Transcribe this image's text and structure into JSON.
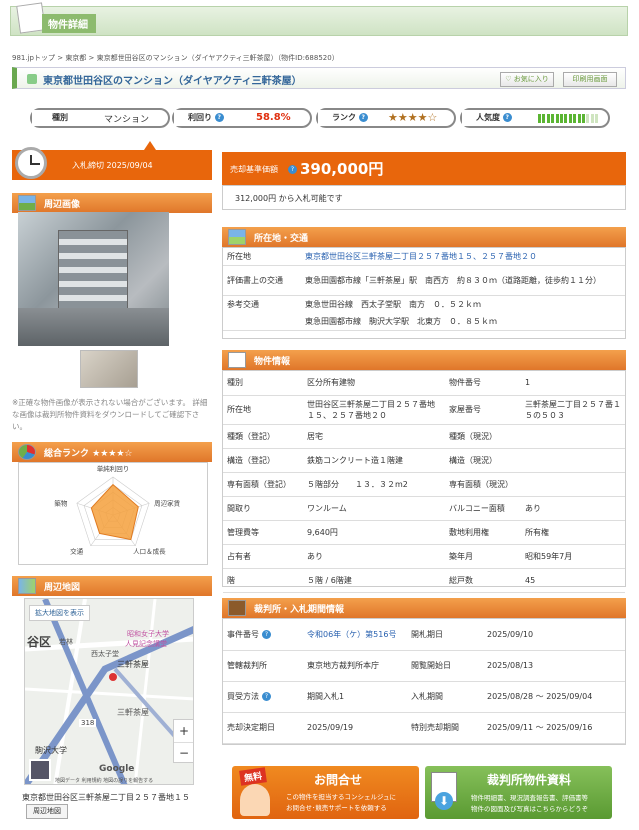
{
  "header": {
    "title": "物件詳細"
  },
  "breadcrumb": [
    "981.jpトップ",
    "東京都",
    "東京都世田谷区のマンション（ダイヤアクティ三軒茶屋）（物件ID:688520）"
  ],
  "property": {
    "title": "東京都世田谷区のマンション（ダイヤアクティ三軒茶屋）",
    "fav_label": "お気に入り",
    "print_label": "印刷用画面"
  },
  "stats": {
    "type_label": "種別",
    "type_value": "マンション",
    "yield_label": "利回り",
    "yield_value": "58.8%",
    "rank_label": "ランク",
    "rank_stars": "★★★★☆",
    "rank_value": 4,
    "popularity_label": "人気度",
    "popularity_level": 0.75
  },
  "auction": {
    "deadline": "入札締切 2025/09/04"
  },
  "price": {
    "label": "売却基準価額",
    "value": "390,000円",
    "sub": "312,000円 から入札可能です"
  },
  "photos": {
    "title": "周辺画像",
    "note": "※正確な物件画像が表示されない場合がございます。 詳細な画像は裁判所物件資料をダウンロードしてご確認下さい。"
  },
  "overall": {
    "title": "総合ランク ★★★★☆",
    "axes": [
      "単純利回り",
      "周辺家賃",
      "人口＆成長",
      "交通",
      "築物"
    ],
    "values": [
      4,
      3.5,
      4,
      3,
      3
    ],
    "max": 5
  },
  "map": {
    "title": "周辺地図",
    "enlarge": "拡大地図を表示",
    "labels": [
      "谷区",
      "三軒茶屋",
      "西太子堂",
      "若林",
      "昭和女子大学",
      "人見記念講堂",
      "三軒茶屋",
      "駒沢大学",
      "318",
      "Google"
    ],
    "attribution": "地図データ 利用規約 地図の誤りを報告する",
    "zoom_in": "+",
    "zoom_out": "−",
    "address": "東京都世田谷区三軒茶屋二丁目２５７番地１５",
    "map_button": "周辺地図"
  },
  "location": {
    "title": "所在地・交通",
    "rows": [
      {
        "label": "所在地",
        "value": "東京都世田谷区三軒茶屋二丁目２５７番地１５、２５７番地２０"
      },
      {
        "label": "評価書上の交通",
        "value": "東急田園都市線「三軒茶屋」駅　南西方　約８３０ｍ（道路距離，徒歩約１１分）"
      },
      {
        "label": "参考交通",
        "value": "東急世田谷線　西太子堂駅　南方　０．５２ｋｍ"
      },
      {
        "label": "",
        "value": "東急田園都市線　駒沢大学駅　北東方　０．８５ｋｍ"
      }
    ]
  },
  "info": {
    "title": "物件情報",
    "rows": [
      [
        "種別",
        "区分所有建物",
        "物件番号",
        "1"
      ],
      [
        "所在地",
        "世田谷区三軒茶屋二丁目２５７番地１５、２５７番地２０",
        "家屋番号",
        "三軒茶屋二丁目２５７番１５の５０３"
      ],
      [
        "種類（登記）",
        "居宅",
        "種類（現況）",
        ""
      ],
      [
        "構造（登記）",
        "鉄筋コンクリート造１階建",
        "構造（現況）",
        ""
      ],
      [
        "専有面積（登記）",
        "５階部分　　１３．３２m2",
        "専有面積（現況）",
        ""
      ],
      [
        "間取り",
        "ワンルーム",
        "バルコニー面積",
        "あり"
      ],
      [
        "管理費等",
        "9,640円",
        "敷地利用権",
        "所有権"
      ],
      [
        "占有者",
        "あり",
        "築年月",
        "昭和59年7月"
      ],
      [
        "階",
        "５階 / 6階建",
        "総戸数",
        "45"
      ]
    ]
  },
  "court": {
    "title": "裁判所・入札期間情報",
    "rows": [
      [
        "事件番号",
        "令和06年（ケ）第516号",
        "開札期日",
        "2025/09/10"
      ],
      [
        "管轄裁判所",
        "東京地方裁判所本庁",
        "閲覧開始日",
        "2025/08/13"
      ],
      [
        "買受方法",
        "期間入札1",
        "入札期間",
        "2025/08/28 〜 2025/09/04"
      ],
      [
        "売却決定期日",
        "2025/09/19",
        "特別売却期間",
        "2025/09/11 〜 2025/09/16"
      ]
    ]
  },
  "cta": {
    "contact_badge": "無料",
    "contact_title": "お問合せ",
    "contact_sub1": "この物件を担当するコンシェルジュに",
    "contact_sub2": "お問合せ･競売サポートを依頼する",
    "docs_title": "裁判所物件資料",
    "docs_sub1": "物件明細書、現況調査報告書、評価書等",
    "docs_sub2": "物件の図面及び写真はこちらからどうぞ"
  }
}
